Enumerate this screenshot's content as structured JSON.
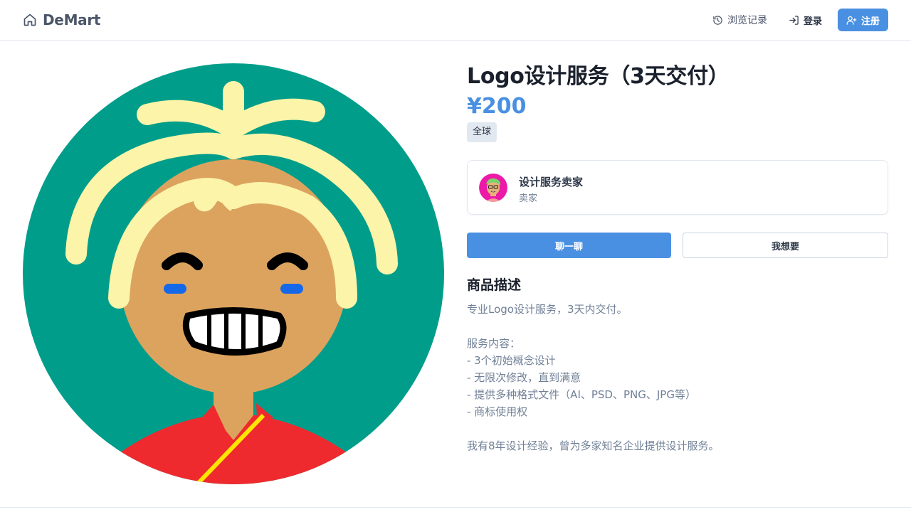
{
  "header": {
    "brand": "DeMart",
    "history_label": "浏览记录",
    "login_label": "登录",
    "register_label": "注册",
    "icons": [
      "home-icon",
      "history-icon",
      "login-icon",
      "user-plus-icon"
    ]
  },
  "product": {
    "title": "Logo设计服务（3天交付）",
    "price": "¥200",
    "region_tag": "全球"
  },
  "seller": {
    "name": "设计服务卖家",
    "role": "卖家"
  },
  "actions": {
    "chat_label": "聊一聊",
    "want_label": "我想要"
  },
  "description": {
    "heading": "商品描述",
    "lines": [
      "专业Logo设计服务，3天内交付。",
      "",
      "服务内容：",
      "- 3个初始概念设计",
      "- 无限次修改，直到满意",
      "- 提供多种格式文件（AI、PSD、PNG、JPG等）",
      "- 商标使用权",
      "",
      "我有8年设计经验，曾为多家知名企业提供设计服务。"
    ]
  },
  "colors": {
    "accent": "#4a90e2",
    "avatar_bg": "#009e8a",
    "hair": "#fbf4a9",
    "skin": "#dca35f",
    "shirt": "#ee2a2e"
  }
}
